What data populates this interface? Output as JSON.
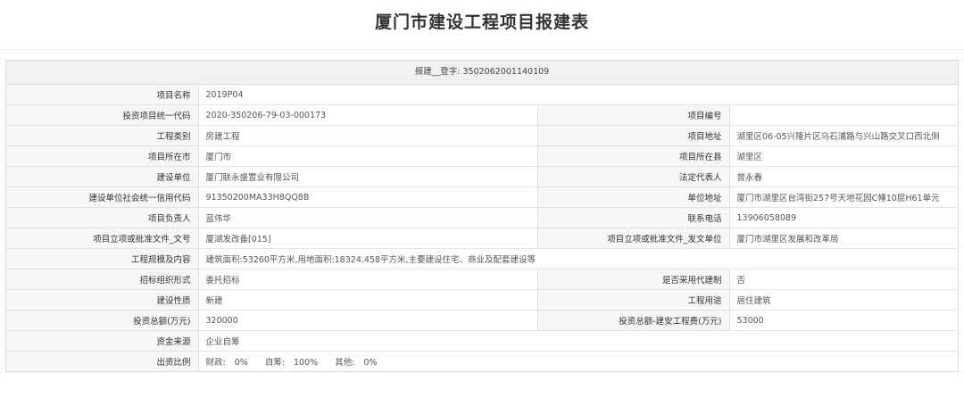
{
  "header": {
    "title": "厦门市建设工程项目报建表"
  },
  "registration": {
    "label": "报建__登字:",
    "number": "3502062001140109"
  },
  "fields": {
    "project_name": {
      "label": "项目名称",
      "value": "2019P04"
    },
    "investment_code": {
      "label": "投资项目统一代码",
      "value": "2020-350206-79-03-000173"
    },
    "project_number": {
      "label": "项目编号",
      "value": ""
    },
    "project_category": {
      "label": "工程类别",
      "value": "房建工程"
    },
    "project_address": {
      "label": "项目地址",
      "value": "湖里区06-05兴隆片区乌石浦路与兴山路交叉口西北侧"
    },
    "project_city": {
      "label": "项目所在市",
      "value": "厦门市"
    },
    "project_county": {
      "label": "项目所在县",
      "value": "湖里区"
    },
    "builder": {
      "label": "建设单位",
      "value": "厦门联永盛置业有限公司"
    },
    "legal_rep": {
      "label": "法定代表人",
      "value": "曾永春"
    },
    "credit_code": {
      "label": "建设单位社会统一信用代码",
      "value": "91350200MA33H8QQ8B"
    },
    "unit_address": {
      "label": "单位地址",
      "value": "厦门市湖里区台湾街257号天地花园C幢10层H61单元"
    },
    "project_leader": {
      "label": "项目负责人",
      "value": "蓝伟华"
    },
    "contact_phone": {
      "label": "联系电话",
      "value": "13906058089"
    },
    "approval_doc_no": {
      "label": "项目立项或批准文件_文号",
      "value": "厦湖发改备[015]"
    },
    "approval_doc_unit": {
      "label": "项目立项或批准文件_发文单位",
      "value": "厦门市湖里区发展和改革局"
    },
    "scale_content": {
      "label": "工程规模及内容",
      "value": "建筑面积:53260平方米,用地面积:18324.458平方米,主要建设住宅、商业及配套建设等"
    },
    "tender_form": {
      "label": "招标组织形式",
      "value": "委托招标"
    },
    "agent_build": {
      "label": "是否采用代建制",
      "value": "否"
    },
    "build_nature": {
      "label": "建设性质",
      "value": "新建"
    },
    "project_use": {
      "label": "工程用途",
      "value": "居住建筑"
    },
    "total_investment": {
      "label": "投资总额(万元)",
      "value": "320000"
    },
    "construction_cost": {
      "label": "投资总额-建安工程费(万元)",
      "value": "53000"
    },
    "fund_source": {
      "label": "资金来源",
      "value": "企业自筹"
    },
    "funding_ratio": {
      "label": "出资比例",
      "fiscal_label": "财政:",
      "fiscal_value": "0%",
      "self_label": "自筹:",
      "self_value": "100%",
      "other_label": "其他:",
      "other_value": "0%"
    }
  }
}
